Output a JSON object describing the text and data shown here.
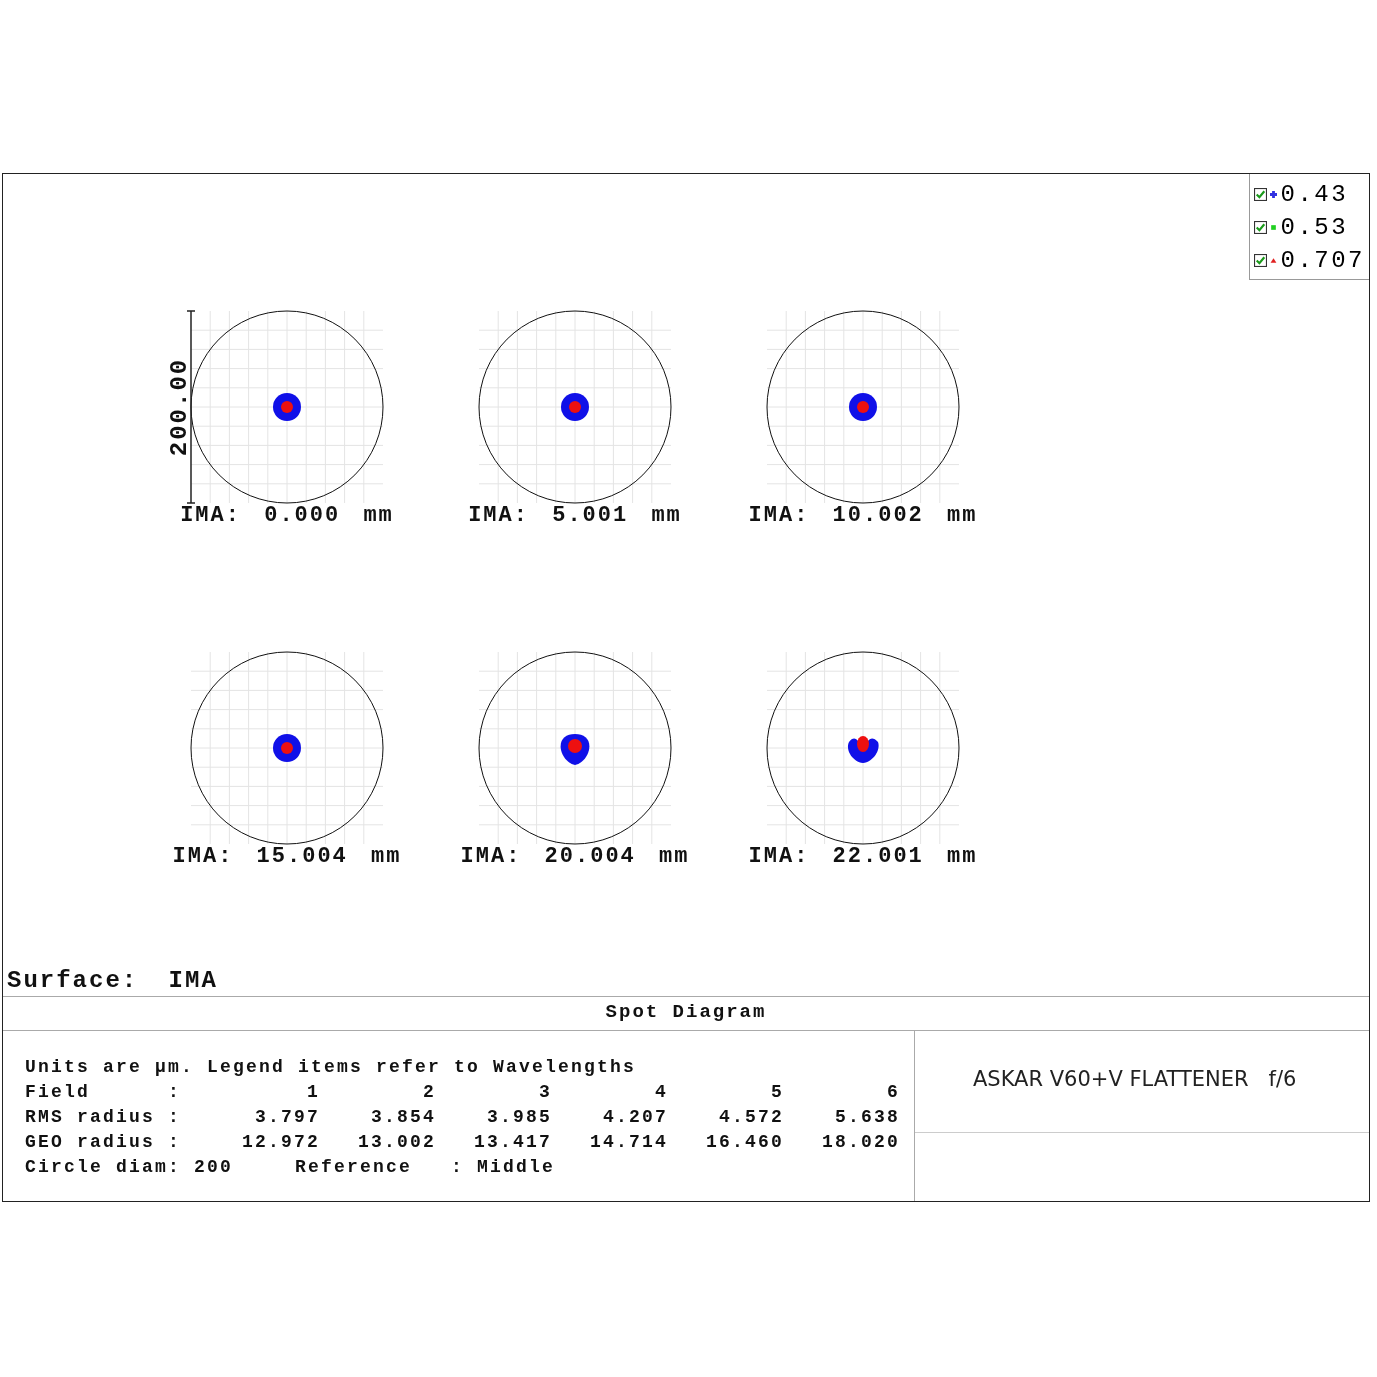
{
  "legend": [
    {
      "label": "0.43",
      "checked": true,
      "kind": "plus",
      "color": "#3030e0"
    },
    {
      "label": "0.53",
      "checked": true,
      "kind": "square",
      "color": "#20d020"
    },
    {
      "label": "0.707",
      "checked": true,
      "kind": "triangle",
      "color": "#e02020"
    }
  ],
  "plots": [
    {
      "label": "IMA: 0.000 mm",
      "scale_label": "200.00"
    },
    {
      "label": "IMA: 5.001 mm"
    },
    {
      "label": "IMA: 10.002 mm"
    },
    {
      "label": "IMA: 15.004 mm"
    },
    {
      "label": "IMA: 20.004 mm"
    },
    {
      "label": "IMA: 22.001 mm"
    }
  ],
  "surface_label": "Surface: IMA",
  "info": {
    "title": "Spot Diagram",
    "heading": "Units are µm. Legend items refer to Wavelengths",
    "rows": [
      {
        "label": "Field",
        "sep": ":",
        "values": [
          "1",
          "2",
          "3",
          "4",
          "5",
          "6"
        ]
      },
      {
        "label": "RMS radius",
        "sep": ":",
        "values": [
          "3.797",
          "3.854",
          "3.985",
          "4.207",
          "4.572",
          "5.638"
        ]
      },
      {
        "label": "GEO radius",
        "sep": ":",
        "values": [
          "12.972",
          "13.002",
          "13.417",
          "14.714",
          "16.460",
          "18.020"
        ]
      }
    ],
    "footer": [
      "Circle diam: 200",
      "Reference   : Middle"
    ],
    "lens_title": "ASKAR V60+V FLATTENER   f/6"
  }
}
